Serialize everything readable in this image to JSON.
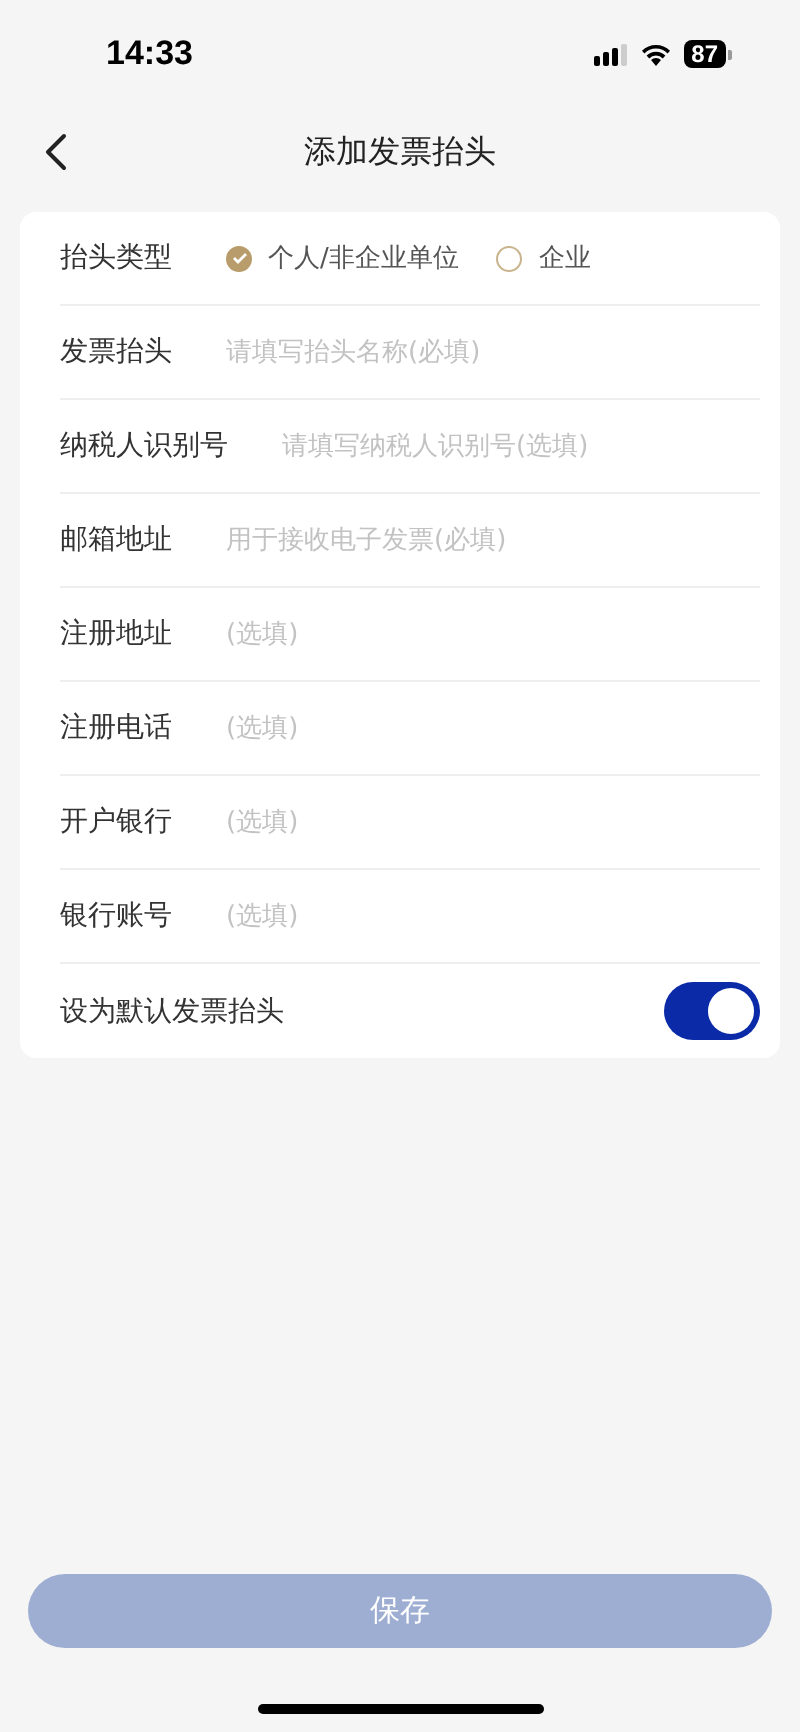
{
  "status_bar": {
    "time": "14:33",
    "battery": "87"
  },
  "nav": {
    "title": "添加发票抬头"
  },
  "form": [
    {
      "kind": "radio",
      "label": "抬头类型",
      "options": [
        {
          "label": "个人/非企业单位",
          "selected": true
        },
        {
          "label": "企业",
          "selected": false
        }
      ]
    },
    {
      "kind": "field",
      "label": "发票抬头",
      "placeholder": "请填写抬头名称(必填)"
    },
    {
      "kind": "field",
      "label": "纳税人识别号",
      "placeholder": "请填写纳税人识别号(选填)"
    },
    {
      "kind": "field",
      "label": "邮箱地址",
      "placeholder": "用于接收电子发票(必填)"
    },
    {
      "kind": "field",
      "label": "注册地址",
      "placeholder": "(选填)"
    },
    {
      "kind": "field",
      "label": "注册电话",
      "placeholder": "(选填)"
    },
    {
      "kind": "field",
      "label": "开户银行",
      "placeholder": "(选填)"
    },
    {
      "kind": "field",
      "label": "银行账号",
      "placeholder": "(选填)"
    },
    {
      "kind": "toggle",
      "label": "设为默认发票抬头",
      "on": true
    }
  ],
  "save_button": {
    "label": "保存",
    "disabled": true
  }
}
